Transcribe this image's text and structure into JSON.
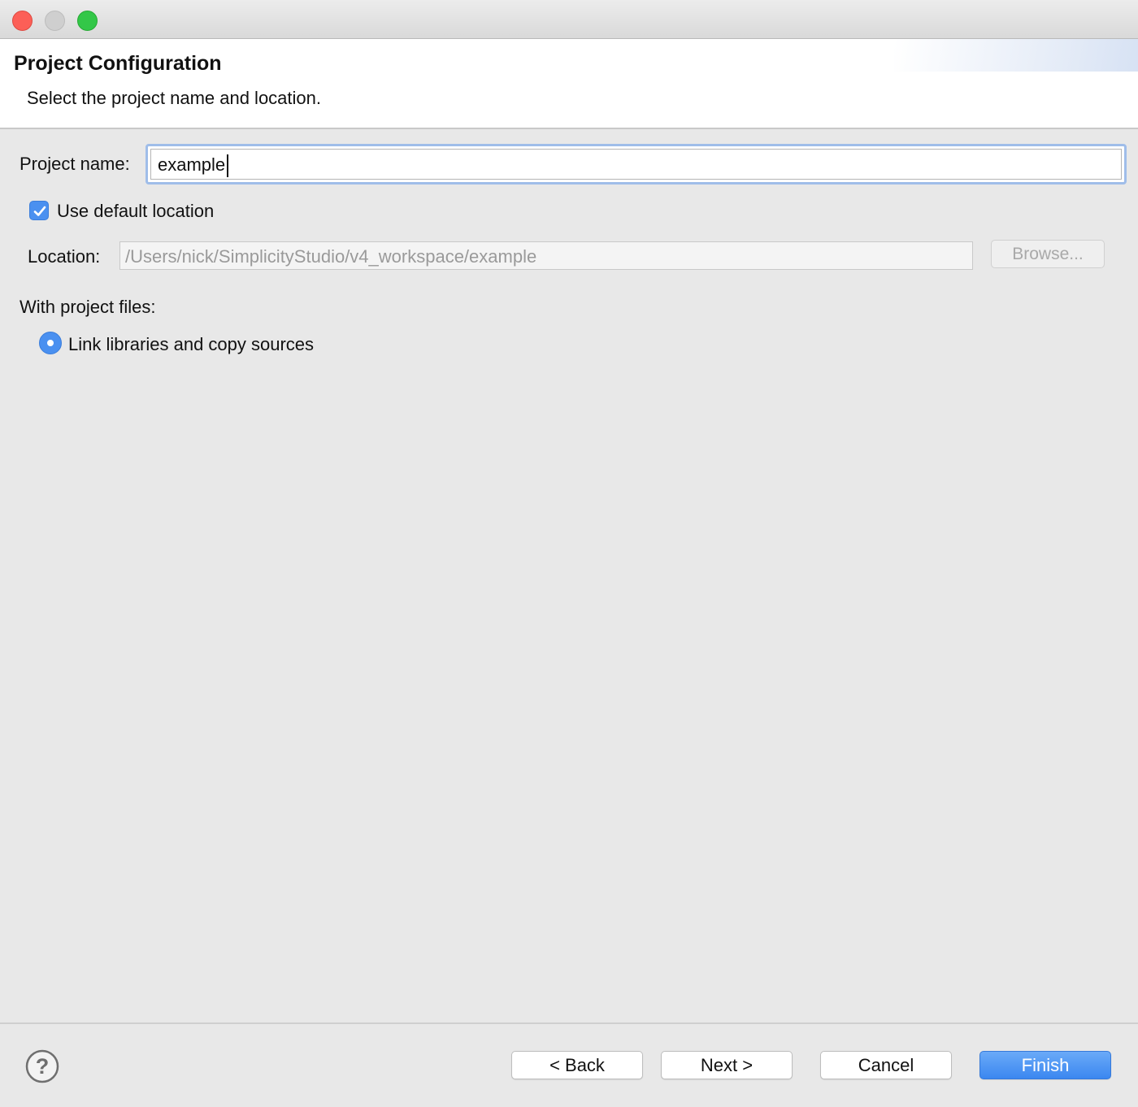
{
  "dialog": {
    "title": "Project Configuration",
    "subtitle": "Select the project name and location."
  },
  "form": {
    "project_name_label": "Project name:",
    "project_name_value": "example",
    "use_default_location_label": "Use default location",
    "use_default_location_checked": true,
    "location_label": "Location:",
    "location_value": "/Users/nick/SimplicityStudio/v4_workspace/example",
    "browse_label": "Browse...",
    "project_files_label": "With project files:",
    "project_files_options": [
      {
        "label": "Link libraries and copy sources",
        "selected": true
      }
    ]
  },
  "footer": {
    "help_icon": "question-mark-icon",
    "back_label": "< Back",
    "next_label": "Next >",
    "cancel_label": "Cancel",
    "finish_label": "Finish"
  },
  "colors": {
    "accent": "#4a90f0",
    "window_bg": "#e8e8e8",
    "close": "#fc5f57",
    "zoom": "#33c748"
  }
}
